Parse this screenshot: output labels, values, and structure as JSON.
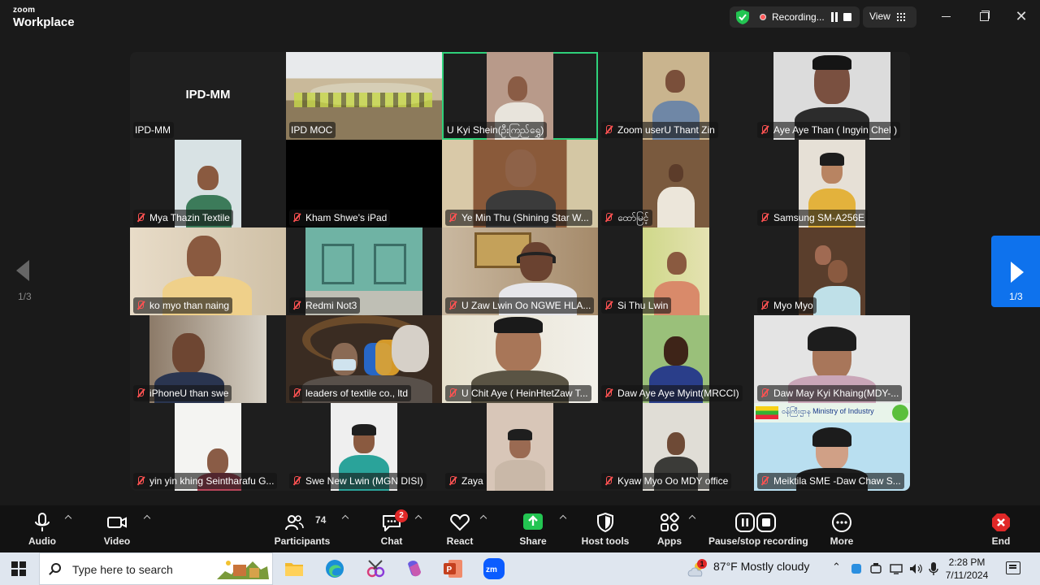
{
  "titlebar": {
    "brand_line1": "zoom",
    "brand_line2": "Workplace",
    "recording_label": "Recording...",
    "view_label": "View",
    "close_glyph": "✕"
  },
  "grid": {
    "host_tile_title": "IPD-MM",
    "participants": [
      {
        "name": "IPD-MM",
        "muted": false
      },
      {
        "name": "IPD MOC",
        "muted": false
      },
      {
        "name": "U Kyi Shein(ဦးကြည်ရွှေ)",
        "muted": false,
        "active_speaker": true
      },
      {
        "name": "Zoom userU Thant Zin",
        "muted": true
      },
      {
        "name": "Aye Aye Than ( Ingyin Chel )",
        "muted": true
      },
      {
        "name": "Mya Thazin Textile",
        "muted": true
      },
      {
        "name": "Kham Shwe's iPad",
        "muted": true
      },
      {
        "name": "Ye Min Thu (Shining Star W...",
        "muted": true
      },
      {
        "name": "ထော်မြင့်",
        "muted": true
      },
      {
        "name": "Samsung SM-A256E",
        "muted": true
      },
      {
        "name": "ko myo than naing",
        "muted": true
      },
      {
        "name": "Redmi Not3",
        "muted": true
      },
      {
        "name": "U Zaw Lwin Oo NGWE HLA...",
        "muted": true
      },
      {
        "name": "Si Thu Lwin",
        "muted": true
      },
      {
        "name": "Myo Myo",
        "muted": true
      },
      {
        "name": "iPhoneU than swe",
        "muted": true
      },
      {
        "name": "leaders of textile co., ltd",
        "muted": true
      },
      {
        "name": "U Chit Aye ( HeinHtetZaw T...",
        "muted": true
      },
      {
        "name": "Daw Aye Aye Myint(MRCCI)",
        "muted": true
      },
      {
        "name": "Daw May Kyi Khaing(MDY-...",
        "muted": true
      },
      {
        "name": "yin yin khing Seintharafu G...",
        "muted": true
      },
      {
        "name": "Swe New Lwin (MGN DISI)",
        "muted": true
      },
      {
        "name": "Zaya",
        "muted": true
      },
      {
        "name": "Kyaw Myo Oo MDY office",
        "muted": true
      },
      {
        "name": "Meiktila SME -Daw Chaw S...",
        "muted": true
      }
    ],
    "ministry_banner": "ဝန်ကြီးဌာန Ministry of Industry"
  },
  "pager": {
    "left_label": "1/3",
    "right_label": "1/3"
  },
  "toolbar": {
    "audio": "Audio",
    "video": "Video",
    "participants": "Participants",
    "participants_count": "74",
    "chat": "Chat",
    "chat_badge": "2",
    "react": "React",
    "share": "Share",
    "host_tools": "Host tools",
    "apps": "Apps",
    "recording": "Pause/stop recording",
    "more": "More",
    "end": "End"
  },
  "taskbar": {
    "search_placeholder": "Type here to search",
    "weather_badge": "1",
    "weather": "87°F  Mostly cloudy",
    "time": "2:28 PM",
    "date": "7/11/2024"
  },
  "colors": {
    "accent": "#0e72ed",
    "active_speaker": "#2fd17a",
    "muted_mic": "#ff5252",
    "end_button": "#e02828"
  }
}
